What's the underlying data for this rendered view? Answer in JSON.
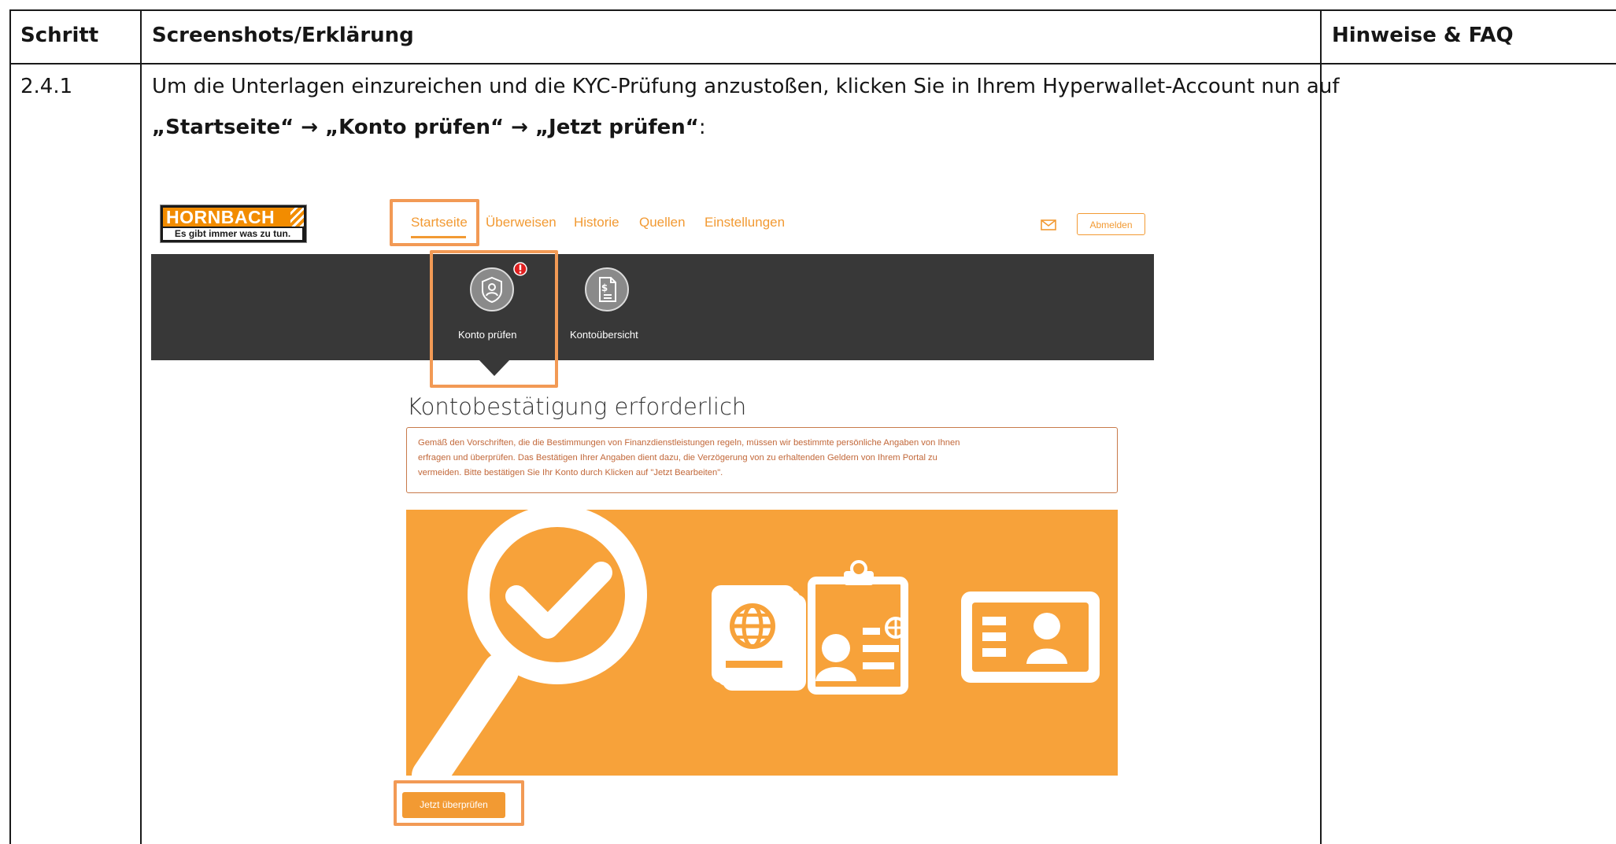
{
  "table": {
    "headers": [
      "Schritt",
      "Screenshots/Erklärung",
      "Hinweise & FAQ"
    ],
    "row": {
      "step": "2.4.1",
      "instruction_line1": "Um die Unterlagen einzureichen und die KYC-Prüfung anzustoßen, klicken Sie in Ihrem Hyperwallet-Account nun auf",
      "instruction_line2_bold": "„Startseite“ → „Konto prüfen“ → „Jetzt prüfen“",
      "instruction_line2_tail": ":"
    }
  },
  "screenshot": {
    "logo": {
      "brand": "HORNBACH",
      "slogan": "Es gibt immer was zu tun."
    },
    "nav": {
      "items": [
        "Startseite",
        "Überweisen",
        "Historie",
        "Quellen",
        "Einstellungen"
      ],
      "active": "Startseite",
      "mail_icon": "mail-icon",
      "logout_label": "Abmelden"
    },
    "band": {
      "items": [
        {
          "label": "Konto prüfen",
          "icon": "shield-user-icon",
          "alert": true
        },
        {
          "label": "Kontoübersicht",
          "icon": "document-dollar-icon",
          "alert": false
        }
      ]
    },
    "verification": {
      "title": "Kontobestätigung erforderlich",
      "notice_lines": [
        "Gemäß den Vorschriften, die die Bestimmungen von Finanzdienstleistungen regeln, müssen wir bestimmte persönliche Angaben von Ihnen",
        "erfragen und überprüfen. Das Bestätigen Ihrer Angaben dient dazu, die Verzögerung von zu erhaltenden Geldern von Ihrem Portal zu",
        "vermeiden. Bitte bestätigen Sie Ihr Konto durch Klicken auf \"Jetzt Bearbeiten\"."
      ],
      "cta_label": "Jetzt überprüfen"
    },
    "colors": {
      "accent": "#f29a33",
      "hero": "#f7a23a",
      "band": "#383838",
      "highlight": "#f29a55",
      "alert": "#e02020"
    }
  }
}
